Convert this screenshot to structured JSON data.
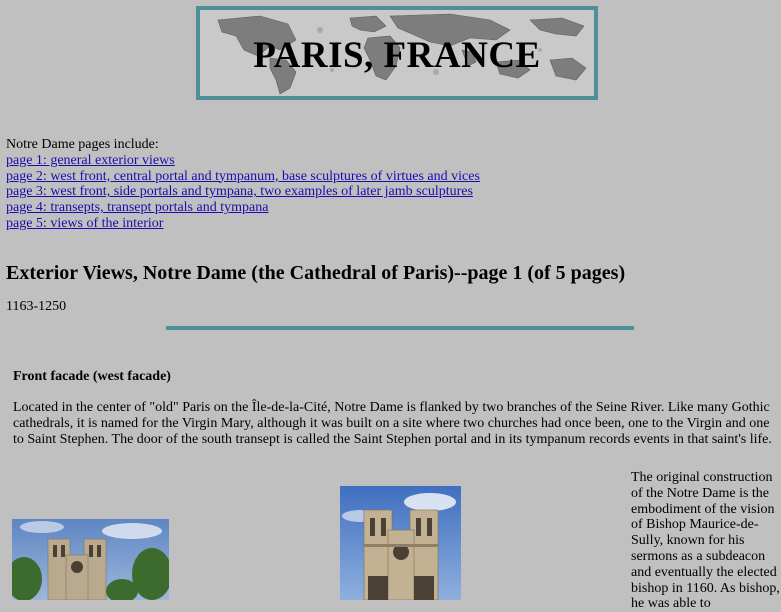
{
  "banner": {
    "title": "PARIS, FRANCE",
    "border_color": "#4f8f98"
  },
  "intro": {
    "lead": "Notre Dame pages include:",
    "links": [
      "page 1: general exterior views",
      "page 2: west front, central portal and tympanum, base sculptures of virtues and vices",
      "page 3: west front, side portals and tympana, two examples of later jamb sculptures",
      "page 4: transepts, transept portals and tympana",
      "page 5: views of the interior"
    ]
  },
  "heading": "Exterior Views, Notre Dame (the Cathedral of Paris)--page 1 (of 5 pages)",
  "dates": "1163-1250",
  "section": {
    "title": "Front facade (west facade)",
    "paragraph": "Located in the center of \"old\" Paris on the Île-de-la-Cité, Notre Dame is flanked by two branches of the Seine River. Like many Gothic cathedrals, it is named for the Virgin Mary, although it was built on a site where two churches had once been, one to the Virgin and one to Saint Stephen. The door of the south transept is called the Saint Stephen portal and in its tympanum records events in that saint's life.",
    "side_text": "The original construction of the Notre Dame is the embodiment of the vision of Bishop Maurice-de-Sully, known for his sermons as a subdeacon and eventually the elected bishop in 1160. As bishop, he was able to"
  },
  "colors": {
    "page_background": "#c0c0c0",
    "link": "#1a0dab",
    "rule": "#4f8f98"
  },
  "icons": [
    "world-map-graphic",
    "notre-dame-photo"
  ]
}
